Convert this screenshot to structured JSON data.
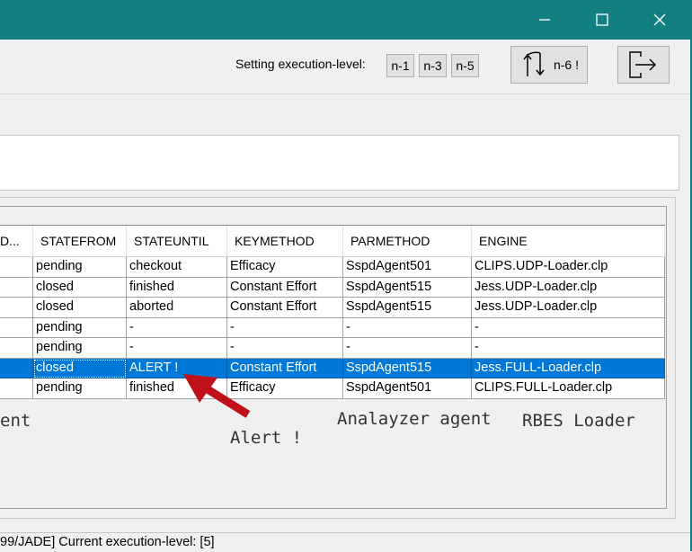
{
  "window": {
    "minimize_glyph": "—",
    "maximize_glyph": "☐",
    "close_glyph": "✕"
  },
  "toolbar": {
    "execution_label": "Setting execution-level:",
    "levels": [
      "n-1",
      "n-3",
      "n-5"
    ],
    "n6_label": "n-6 !"
  },
  "table": {
    "columns": [
      "D...",
      "STATEFROM",
      "STATEUNTIL",
      "KEYMETHOD",
      "PARMETHOD",
      "ENGINE"
    ],
    "rows": [
      [
        "",
        "pending",
        "checkout",
        "Efficacy",
        "SspdAgent501",
        "CLIPS.UDP-Loader.clp"
      ],
      [
        "",
        "closed",
        "finished",
        "Constant Effort",
        "SspdAgent515",
        "Jess.UDP-Loader.clp"
      ],
      [
        "",
        "closed",
        "aborted",
        "Constant Effort",
        "SspdAgent515",
        "Jess.UDP-Loader.clp"
      ],
      [
        "",
        "pending",
        "-",
        "-",
        "-",
        "-"
      ],
      [
        "",
        "pending",
        "-",
        "-",
        "-",
        "-"
      ],
      [
        "",
        "closed",
        "ALERT !",
        "Constant Effort",
        "SspdAgent515",
        "Jess.FULL-Loader.clp"
      ],
      [
        "",
        "pending",
        "finished",
        "Efficacy",
        "SspdAgent501",
        "CLIPS.FULL-Loader.clp"
      ]
    ],
    "selected_row": 5
  },
  "annotations": {
    "agent_fragment": "ent",
    "alert": "Alert !",
    "analyzer": "Analayzer agent",
    "rbes": "RBES Loader"
  },
  "colors": {
    "titlebar": "#128083",
    "selection": "#0078d7",
    "arrow": "#c0101a"
  },
  "status": {
    "text": "99/JADE] Current execution-level: [5]"
  }
}
